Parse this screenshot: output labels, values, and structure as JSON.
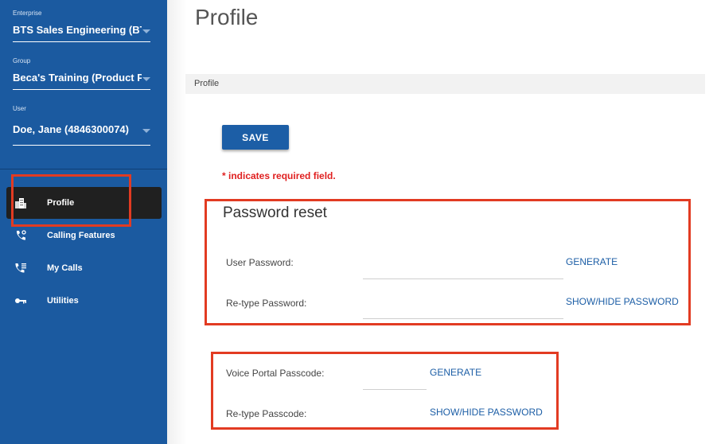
{
  "sidebar": {
    "enterprise": {
      "caption": "Enterprise",
      "value": "BTS Sales Engineering (BTS"
    },
    "group": {
      "caption": "Group",
      "value": "Beca's Training (Product Phil"
    },
    "user": {
      "caption": "User",
      "value": "Doe, Jane (4846300074)"
    },
    "nav": [
      {
        "label": "Profile",
        "icon": "building-icon",
        "active": true
      },
      {
        "label": "Calling Features",
        "icon": "phone-icon",
        "active": false
      },
      {
        "label": "My Calls",
        "icon": "call-list-icon",
        "active": false
      },
      {
        "label": "Utilities",
        "icon": "key-icon",
        "active": false
      }
    ]
  },
  "page": {
    "title": "Profile",
    "breadcrumb": "Profile",
    "save_label": "SAVE",
    "required_note": "* indicates required field."
  },
  "password_reset": {
    "title": "Password reset",
    "user_password_label": "User Password:",
    "retype_password_label": "Re-type Password:",
    "generate_label": "GENERATE",
    "show_hide_label": "SHOW/HIDE PASSWORD"
  },
  "passcode": {
    "voice_portal_label": "Voice Portal Passcode:",
    "retype_passcode_label": "Re-type Passcode:",
    "generate_label": "GENERATE",
    "show_hide_label": "SHOW/HIDE PASSWORD"
  },
  "colors": {
    "sidebar": "#1b5aa0",
    "active_nav": "#202020",
    "accent": "#1c5ea6",
    "required": "#e02020",
    "highlight_box": "#e23b22"
  }
}
